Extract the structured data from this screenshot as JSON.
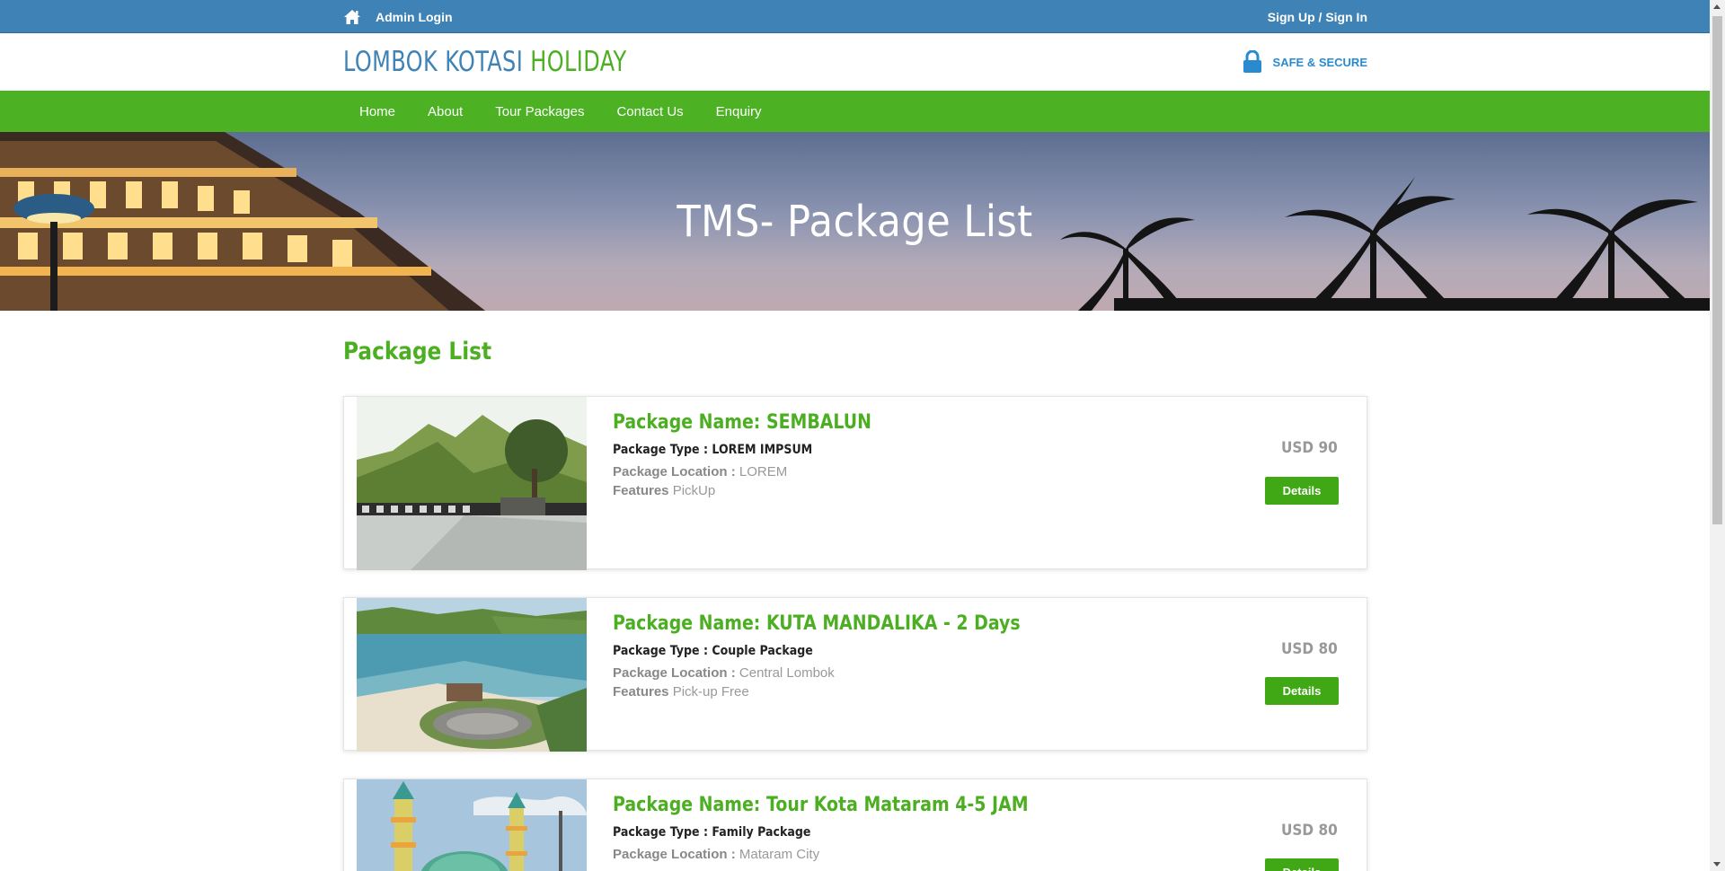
{
  "topbar": {
    "admin_label": "Admin Login",
    "signin_label": "Sign Up / Sign In",
    "color": "#3f83b6"
  },
  "header": {
    "logo_part1": "LOMBOK KOTASI",
    "logo_part2": "HOLIDAY",
    "secure_label": "SAFE & SECURE",
    "secure_icon": "lock-icon"
  },
  "nav": {
    "color": "#4cb224",
    "items": [
      "Home",
      "About",
      "Tour Packages",
      "Contact Us",
      "Enquiry"
    ]
  },
  "banner": {
    "title": "TMS- Package List"
  },
  "main": {
    "section_title": "Package List",
    "packages": [
      {
        "name": "Package Name: SEMBALUN",
        "type_label": "Package Type : LOREM IMPSUM",
        "location_label": "Package Location :",
        "location": "LOREM",
        "features_label": "Features",
        "features": "PickUp",
        "price": "USD 90",
        "button": "Details"
      },
      {
        "name": "Package Name: KUTA MANDALIKA - 2 Days",
        "type_label": "Package Type : Couple Package",
        "location_label": "Package Location :",
        "location": "Central Lombok",
        "features_label": "Features",
        "features": "Pick-up Free",
        "price": "USD 80",
        "button": "Details"
      },
      {
        "name": "Package Name: Tour Kota Mataram 4-5 JAM",
        "type_label": "Package Type : Family Package",
        "location_label": "Package Location :",
        "location": "Mataram City",
        "price": "USD 80",
        "button": "Details"
      }
    ]
  }
}
